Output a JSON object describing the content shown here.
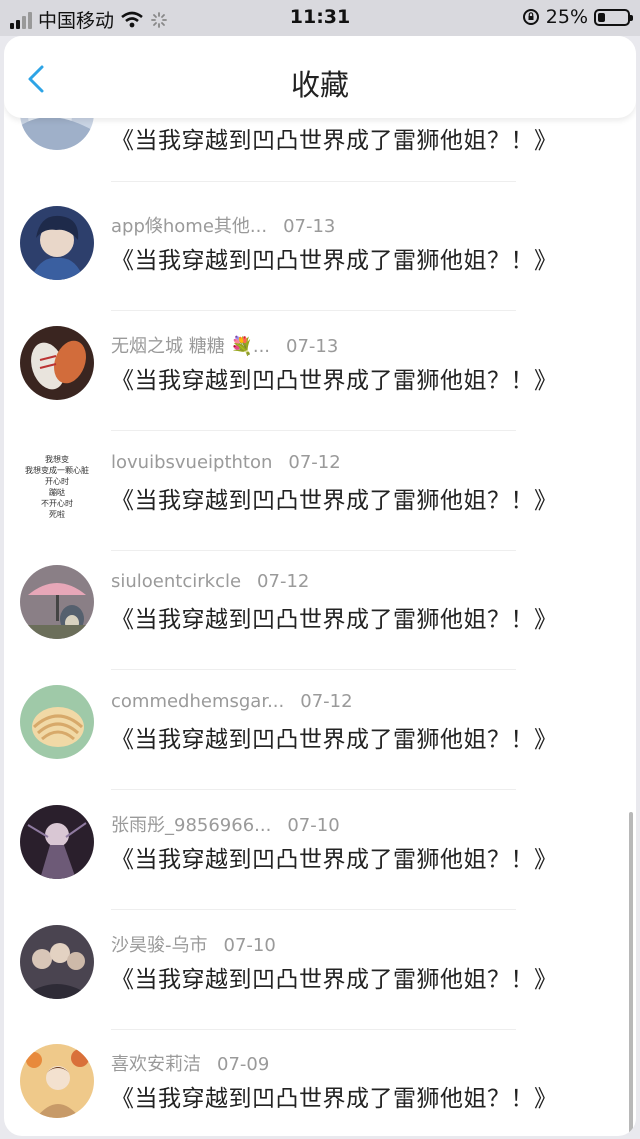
{
  "status_bar": {
    "carrier": "中国移动",
    "time": "11:31",
    "battery_percent_text": "25%",
    "battery_level": 0.25
  },
  "nav": {
    "title": "收藏"
  },
  "colors": {
    "accent": "#2ea4e6",
    "meta_text": "#9a9a9a"
  },
  "items": [
    {
      "name": "",
      "date": "",
      "title": "《当我穿越到凹凸世界成了雷狮他姐？！》",
      "avatar": "partial-cropped-avatar"
    },
    {
      "name": "app倏home其他...",
      "date": "07-13",
      "title": "《当我穿越到凹凸世界成了雷狮他姐？！》",
      "avatar": "anime-boy-avatar"
    },
    {
      "name": "无烟之城 糖糖 💐...",
      "date": "07-13",
      "title": "《当我穿越到凹凸世界成了雷狮他姐？！》",
      "avatar": "sneakers-avatar"
    },
    {
      "name": "lovuibsvueipthton",
      "date": "07-12",
      "title": "《当我穿越到凹凸世界成了雷狮他姐？！》",
      "avatar": "text-avatar",
      "avatar_text": [
        "我想变",
        "我想变成一颗心脏",
        "开心时",
        "蹦哒",
        "不开心时",
        "死啦"
      ]
    },
    {
      "name": "siuloentcirkcle",
      "date": "07-12",
      "title": "《当我穿越到凹凸世界成了雷狮他姐？！》",
      "avatar": "totoro-avatar"
    },
    {
      "name": "commedhemsgar...",
      "date": "07-12",
      "title": "《当我穿越到凹凸世界成了雷狮他姐？！》",
      "avatar": "seashell-avatar"
    },
    {
      "name": "张雨彤_9856966...",
      "date": "07-10",
      "title": "《当我穿越到凹凸世界成了雷狮他姐？！》",
      "avatar": "dark-anime-avatar"
    },
    {
      "name": "沙昊骏-乌市",
      "date": "07-10",
      "title": "《当我穿越到凹凸世界成了雷狮他姐？！》",
      "avatar": "group-anime-avatar"
    },
    {
      "name": "喜欢安莉洁",
      "date": "07-09",
      "title": "《当我穿越到凹凸世界成了雷狮他姐？！》",
      "avatar": "autumn-girl-avatar"
    }
  ]
}
